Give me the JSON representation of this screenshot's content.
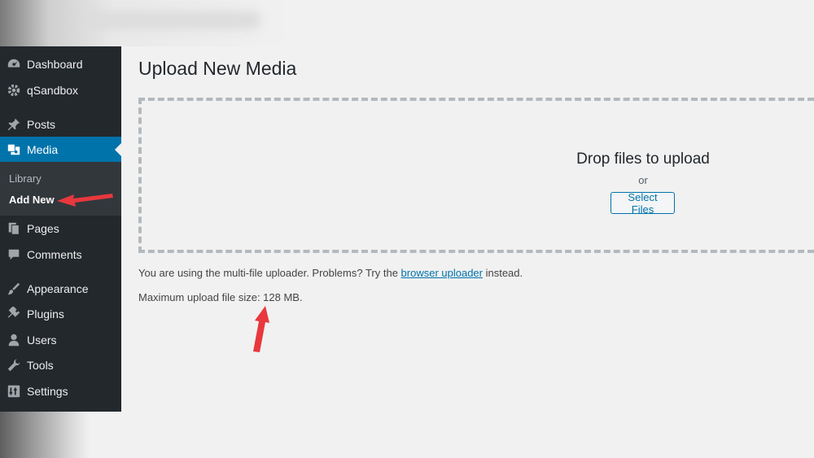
{
  "sidebar": {
    "items": [
      {
        "label": "Dashboard",
        "icon": "dashboard-icon"
      },
      {
        "label": "qSandbox",
        "icon": "gear-icon"
      },
      {
        "label": "Posts",
        "icon": "pin-icon"
      },
      {
        "label": "Media",
        "icon": "media-icon",
        "active": true
      },
      {
        "label": "Pages",
        "icon": "pages-icon"
      },
      {
        "label": "Comments",
        "icon": "comment-icon"
      },
      {
        "label": "Appearance",
        "icon": "brush-icon"
      },
      {
        "label": "Plugins",
        "icon": "plugin-icon"
      },
      {
        "label": "Users",
        "icon": "user-icon"
      },
      {
        "label": "Tools",
        "icon": "wrench-icon"
      },
      {
        "label": "Settings",
        "icon": "settings-icon"
      }
    ],
    "submenu": [
      {
        "label": "Library"
      },
      {
        "label": "Add New",
        "current": true
      }
    ]
  },
  "main": {
    "title": "Upload New Media",
    "dropzone": {
      "heading": "Drop files to upload",
      "or": "or",
      "button": "Select Files"
    },
    "uploader_note": {
      "before": "You are using the multi-file uploader. Problems? Try the ",
      "link": "browser uploader",
      "after": " instead."
    },
    "max_size": "Maximum upload file size: 128 MB."
  },
  "colors": {
    "sidebar_bg": "#23282d",
    "active_bg": "#0073aa",
    "annotation_arrow": "#e8383d"
  }
}
